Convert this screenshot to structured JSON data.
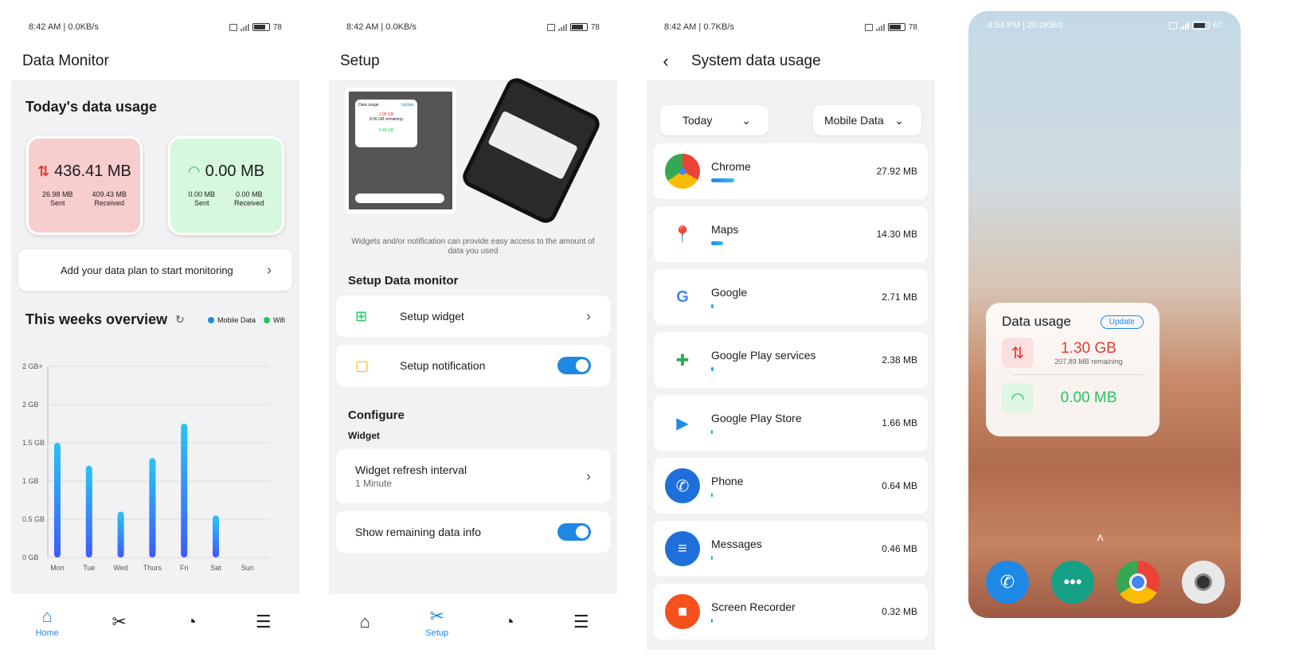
{
  "screen1": {
    "status": {
      "time": "8:42 AM | 0.0KB/s",
      "battery": "78"
    },
    "title": "Data Monitor",
    "today_title": "Today's data usage",
    "mobile": {
      "total": "436.41 MB",
      "sent": "26.98 MB",
      "sent_label": "Sent",
      "received": "409.43 MB",
      "received_label": "Received"
    },
    "wifi": {
      "total": "0.00 MB",
      "sent": "0.00 MB",
      "sent_label": "Sent",
      "received": "0.00 MB",
      "received_label": "Received"
    },
    "plan_text": "Add your data plan to start monitoring",
    "week_title": "This weeks overview",
    "legend": [
      "Mobile Data",
      "Wifi"
    ],
    "nav": {
      "home": "Home"
    }
  },
  "chart_data": {
    "type": "bar",
    "categories": [
      "Mon",
      "Tue",
      "Wed",
      "Thurs",
      "Fri",
      "Sat",
      "Sun"
    ],
    "series": [
      {
        "name": "Mobile Data",
        "values": [
          1.5,
          1.2,
          0.6,
          1.3,
          1.75,
          0.55,
          0
        ]
      }
    ],
    "y_ticks": [
      "0 GB",
      "0.5 GB",
      "1 GB",
      "1.5 GB",
      "2 GB",
      "2 GB+"
    ],
    "ylim": [
      0,
      2.5
    ],
    "grid": true,
    "legend": "top-right"
  },
  "screen2": {
    "status": {
      "time": "8:42 AM | 0.0KB/s",
      "battery": "78"
    },
    "title": "Setup",
    "preview_widget": {
      "title": "Data usage",
      "update": "Update",
      "mobile": "1.05 GB",
      "remaining": "8.95 GB remaining",
      "wifi": "6.46 GB"
    },
    "caption": "Widgets and/or notification can provide easy access to the amount of data you used",
    "setup_heading": "Setup Data monitor",
    "setup_widget": "Setup widget",
    "setup_notification": "Setup notification",
    "configure_heading": "Configure",
    "widget_sub": "Widget",
    "refresh_label": "Widget refresh interval",
    "refresh_value": "1 Minute",
    "remaining_label": "Show remaining data info",
    "nav": {
      "setup": "Setup"
    }
  },
  "screen3": {
    "status": {
      "time": "8:42 AM | 0.7KB/s",
      "battery": "78"
    },
    "title": "System data usage",
    "period": "Today",
    "network": "Mobile Data",
    "apps": [
      {
        "name": "Chrome",
        "size": "27.92 MB",
        "usage": 0.31
      },
      {
        "name": "Maps",
        "size": "14.30 MB",
        "usage": 0.16
      },
      {
        "name": "Google",
        "size": "2.71 MB",
        "usage": 0.03
      },
      {
        "name": "Google Play services",
        "size": "2.38 MB",
        "usage": 0.03
      },
      {
        "name": "Google Play Store",
        "size": "1.66 MB",
        "usage": 0.02
      },
      {
        "name": "Phone",
        "size": "0.64 MB",
        "usage": 0.01
      },
      {
        "name": "Messages",
        "size": "0.46 MB",
        "usage": 0.01
      },
      {
        "name": "Screen Recorder",
        "size": "0.32 MB",
        "usage": 0.01
      }
    ]
  },
  "screen4": {
    "status": {
      "time": "4:54 PM | 20.0KB/s",
      "battery": "67"
    },
    "widget": {
      "title": "Data usage",
      "update": "Update",
      "mobile": "1.30 GB",
      "remaining": "207.89 MB remaining",
      "wifi": "0.00 MB"
    }
  }
}
